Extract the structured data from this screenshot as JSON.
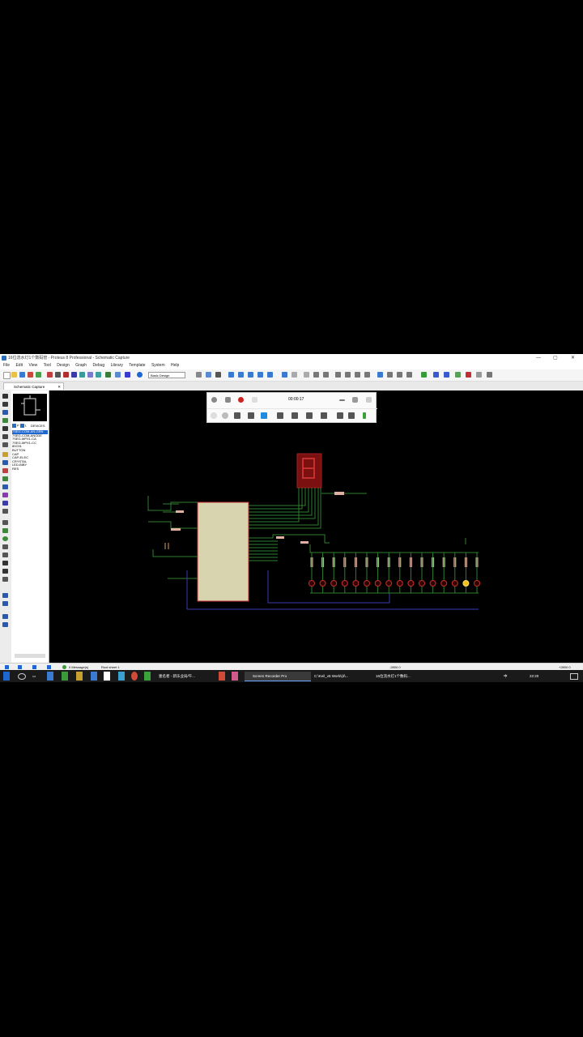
{
  "window": {
    "title": "16位流水灯1个数码管 - Proteus 8 Professional - Schematic Capture",
    "controls": [
      "—",
      "▢",
      "✕"
    ]
  },
  "menu": [
    "File",
    "Edit",
    "View",
    "Tool",
    "Design",
    "Graph",
    "Debug",
    "Library",
    "Template",
    "System",
    "Help"
  ],
  "toolbar": {
    "combo_value": "Basic Design"
  },
  "tab": {
    "label": "Schematic Capture",
    "close": "✕"
  },
  "device_panel": {
    "p_button": "P",
    "l_button": "L",
    "header": "DEVICES",
    "selected_index": 0,
    "items": [
      "7SEG-COM-AN-GRN",
      "7SEG-COM-ANODE",
      "7SEG-MPX1-CA",
      "7SEG-MPX1-CC",
      "80C51",
      "BUTTON",
      "CAP",
      "CAP-ELEC",
      "CRYSTAL",
      "LED-BIBY",
      "RES"
    ]
  },
  "status": {
    "messages": "0 Message(s)",
    "sheet": "Root sheet 1",
    "coord_x": "-2800.0",
    "coord_y": "+2800.0"
  },
  "recorder": {
    "time": "00:00:17"
  },
  "taskbar": {
    "items": [
      "壹名者 - 新乐业局/午...",
      "Screen Recorder Pro",
      "C:\\Keil_v5 Work\\(d\\...",
      "16位流水灯1个数码..."
    ],
    "time": "22:20",
    "ime": "中"
  },
  "colors": {
    "canvas": "#000000",
    "wire_green": "#2f7f2f",
    "wire_blue": "#1a1aa8",
    "chip": "#d8d4b0",
    "segment_red": "#7a1010",
    "accent": "#1e66d0"
  }
}
